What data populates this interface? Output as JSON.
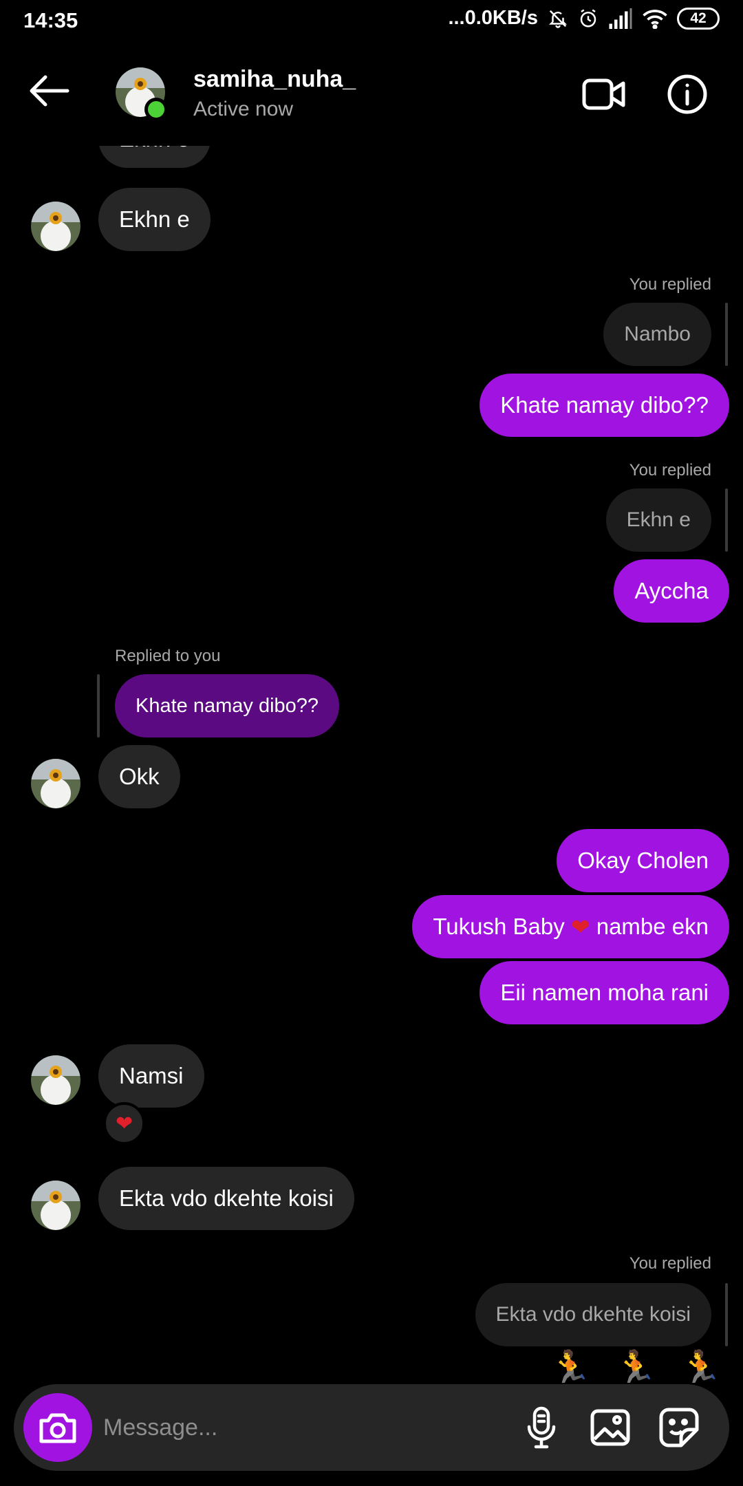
{
  "status_bar": {
    "time": "14:35",
    "network_speed": "...0.0KB/s",
    "battery": "42"
  },
  "header": {
    "username": "samiha_nuha_",
    "status": "Active now"
  },
  "messages": {
    "in_top_partial": "Ekhn e",
    "in_1": "Ekhn e",
    "reply_label_1": "You replied",
    "quote_1": "Nambo",
    "out_1": "Khate namay dibo??",
    "reply_label_2": "You replied",
    "quote_2": "Ekhn e",
    "out_2": "Ayccha",
    "reply_label_3": "Replied to you",
    "quote_3": "Khate namay dibo??",
    "in_2": "Okk",
    "out_3": "Okay Cholen",
    "out_4_before": "Tukush Baby ",
    "out_4_after": " nambe ekn",
    "out_5": "Eii namen moha rani",
    "in_3": "Namsi",
    "in_4": "Ekta vdo dkehte koisi",
    "reply_label_4": "You replied",
    "quote_4": "Ekta vdo dkehte koisi"
  },
  "composer": {
    "placeholder": "Message..."
  },
  "icons": {
    "back": "arrow-left-icon",
    "video": "video-camera-icon",
    "info": "info-icon",
    "camera": "camera-icon",
    "mic": "microphone-icon",
    "gallery": "image-icon",
    "sticker": "sticker-icon"
  },
  "colors": {
    "accent": "#a013e0",
    "incoming_bubble": "#262626",
    "online": "#4cd137"
  }
}
